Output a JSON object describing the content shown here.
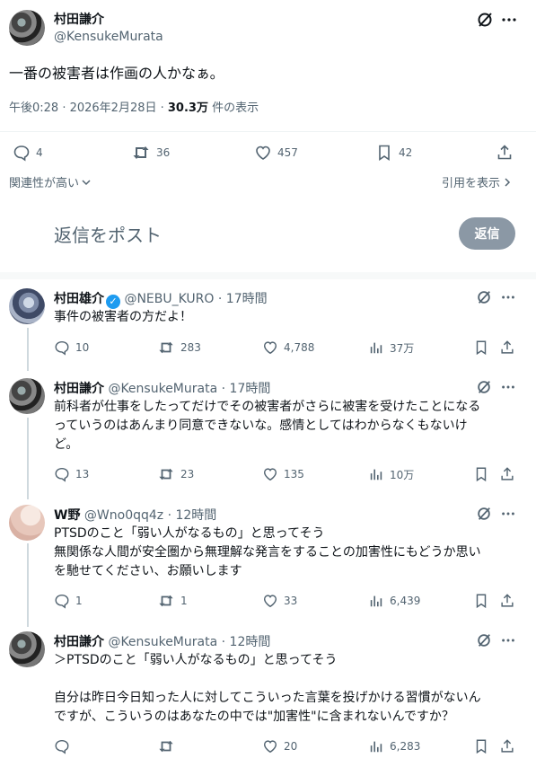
{
  "main_tweet": {
    "author_name": "村田謙介",
    "author_handle": "@KensukeMurata",
    "text": "一番の被害者は作画の人かなぁ。",
    "time": "午後0:28 · 2026年2月28日 · ",
    "views_count": "30.3万",
    "views_label": " 件の表示",
    "stats": {
      "replies": "4",
      "retweets": "36",
      "likes": "457",
      "bookmarks": "42"
    }
  },
  "sort": {
    "label": "関連性が高い",
    "quotes_label": "引用を表示"
  },
  "compose": {
    "placeholder": "返信をポスト",
    "button": "返信"
  },
  "replies": [
    {
      "name": "村田雄介",
      "handle": "@NEBU_KURO",
      "time": "17時間",
      "verified": true,
      "lines": [
        "事件の被害者の方だよ！"
      ],
      "stats": {
        "replies": "10",
        "retweets": "283",
        "likes": "4,788",
        "views": "37万"
      }
    },
    {
      "name": "村田謙介",
      "handle": "@KensukeMurata",
      "time": "17時間",
      "lines": [
        "前科者が仕事をしたってだけでその被害者がさらに被害を受けたことになる",
        "っていうのはあんまり同意できないな。感情としてはわからなくもないけ",
        "ど。"
      ],
      "stats": {
        "replies": "13",
        "retweets": "23",
        "likes": "135",
        "views": "10万"
      }
    },
    {
      "name": "W野",
      "handle": "@Wno0qq4z",
      "time": "12時間",
      "lines": [
        "PTSDのこと「弱い人がなるもの」と思ってそう",
        "無関係な人間が安全圏から無理解な発言をすることの加害性にもどうか思い",
        "を馳せてください、お願いします"
      ],
      "stats": {
        "replies": "1",
        "retweets": "1",
        "likes": "33",
        "views": "6,439"
      }
    },
    {
      "name": "村田謙介",
      "handle": "@KensukeMurata",
      "time": "12時間",
      "lines": [
        "＞PTSDのこと「弱い人がなるもの」と思ってそう",
        "自分は昨日今日知った人に対してこういった言葉を投げかける習慣がないん",
        "ですが、こういうのはあなたの中では\"加害性\"に含まれないんですか？"
      ],
      "stats": {
        "replies": "",
        "retweets": "",
        "likes": "20",
        "views": "6,283"
      }
    }
  ],
  "separator": " · "
}
